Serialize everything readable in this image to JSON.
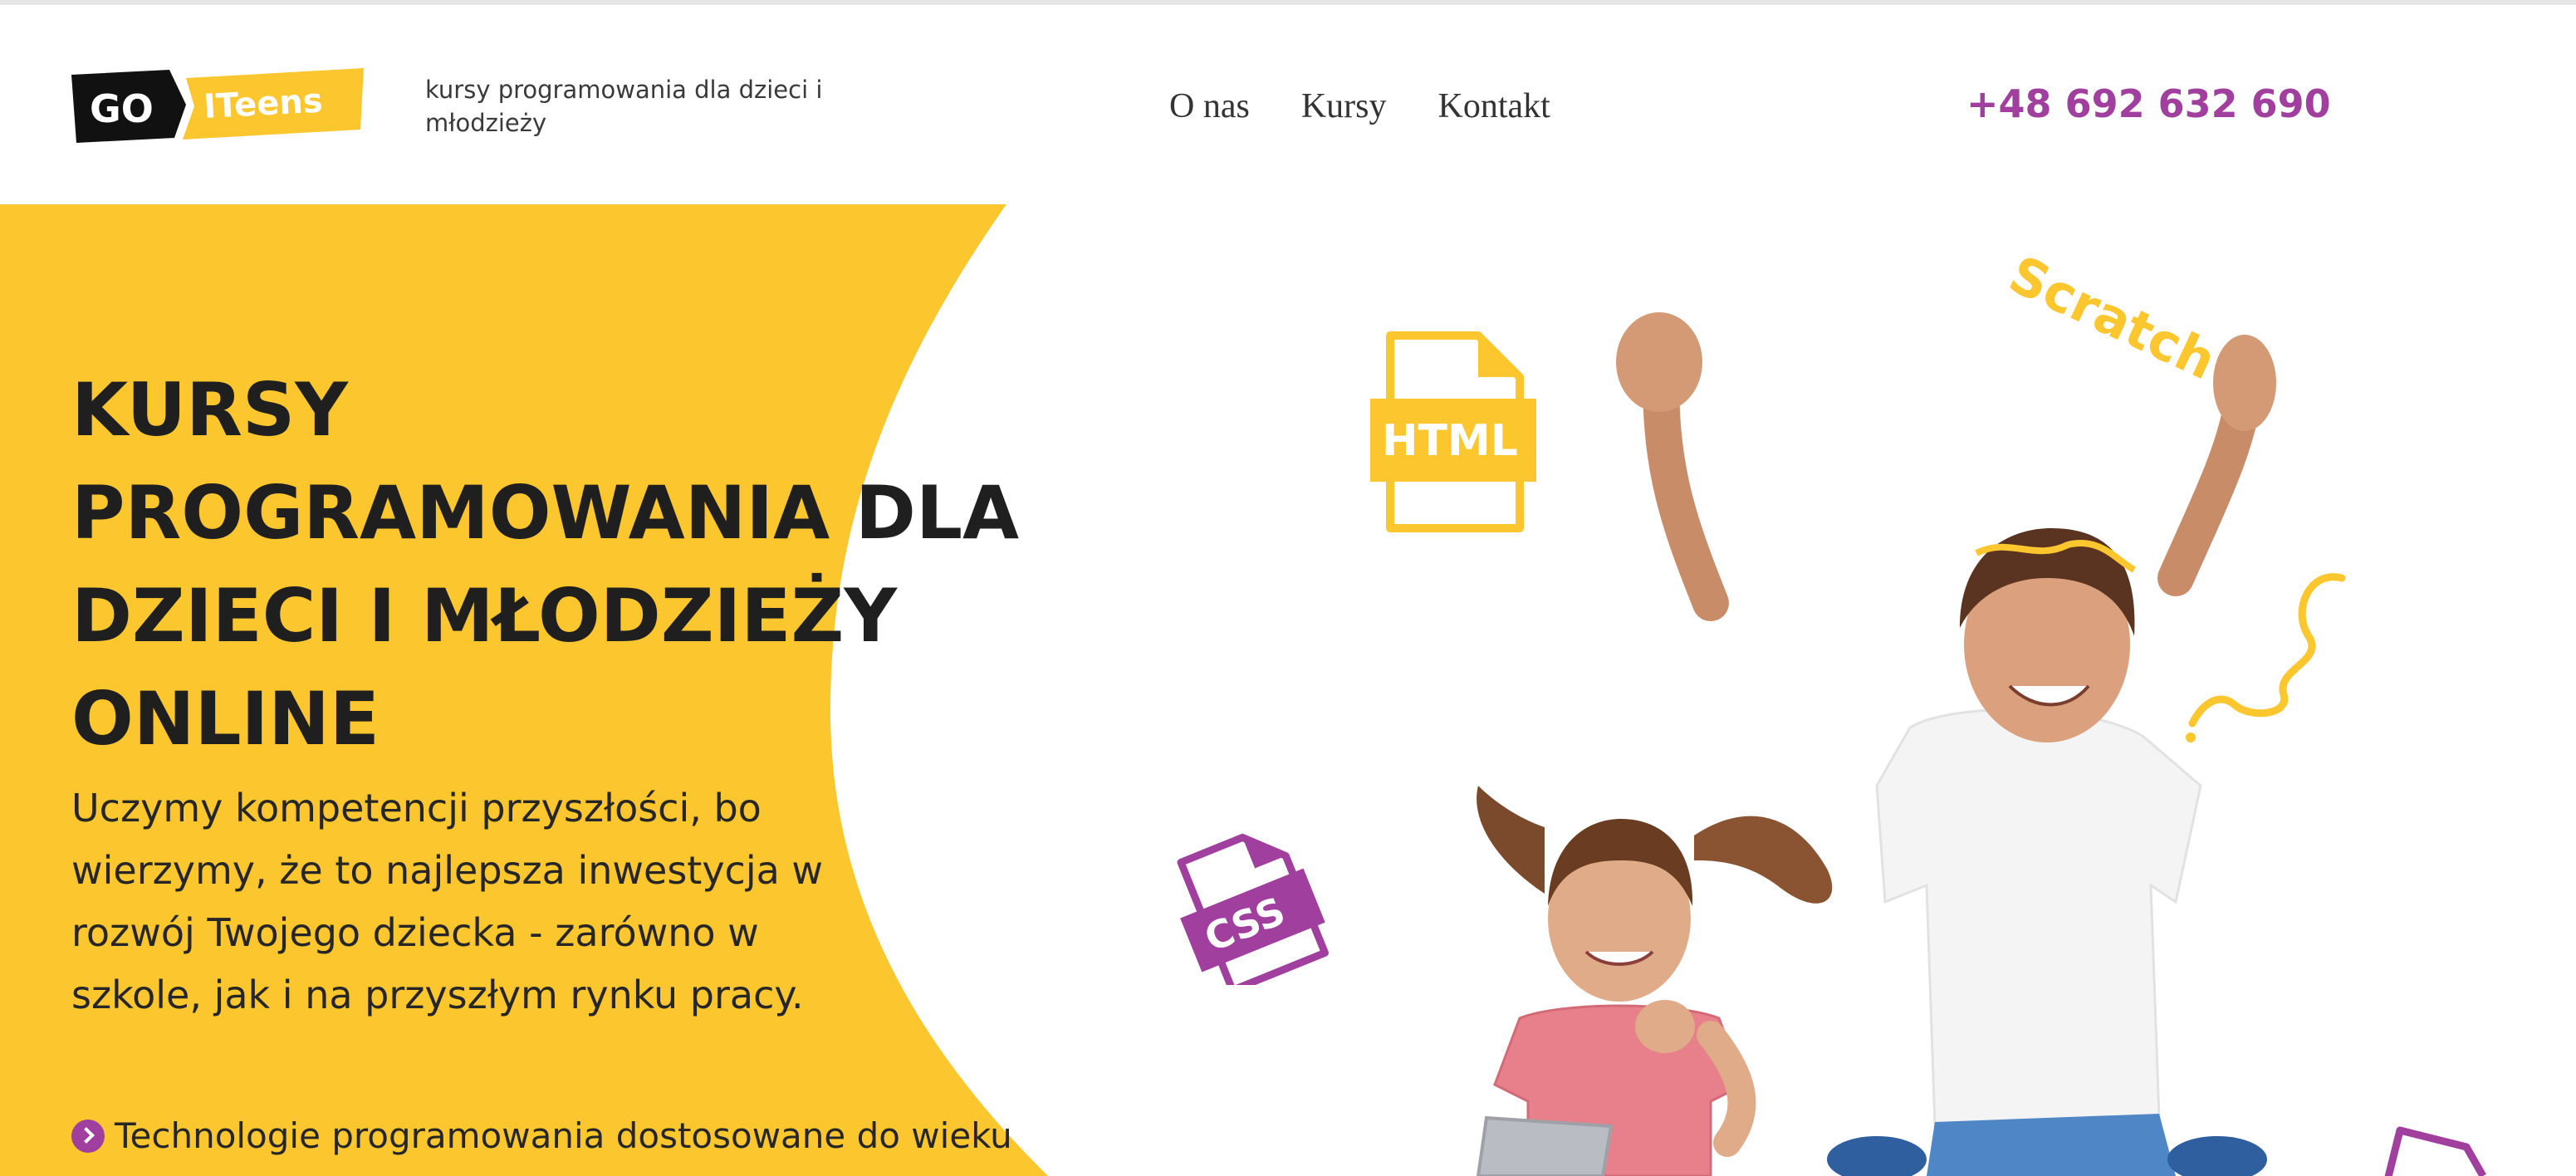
{
  "colors": {
    "yellow": "#fcc62e",
    "purple": "#a03f9d",
    "dark": "#1f1f1f"
  },
  "header": {
    "logo": {
      "part1": "GO",
      "part2": "ITeens"
    },
    "tagline": "kursy programowania dla dzieci i młodzieży",
    "nav": [
      {
        "label": "O nas"
      },
      {
        "label": "Kursy"
      },
      {
        "label": "Kontakt"
      }
    ],
    "phone": "+48 692 632 690"
  },
  "hero": {
    "title": "KURSY\nPROGRAMOWANIA DLA\nDZIECI I MŁODZIEŻY\nONLINE",
    "description": "Uczymy kompetencji przyszłości, bo wierzymy, że to najlepsza inwestycja w rozwój Twojego dziecka - zarówno w szkole, jak i na przyszłym rynku pracy.",
    "feature_text": "Technologie programowania dostosowane do wieku",
    "illustrations": {
      "html_label": "HTML",
      "css_label": "CSS",
      "scratch_label": "Scratch"
    }
  }
}
